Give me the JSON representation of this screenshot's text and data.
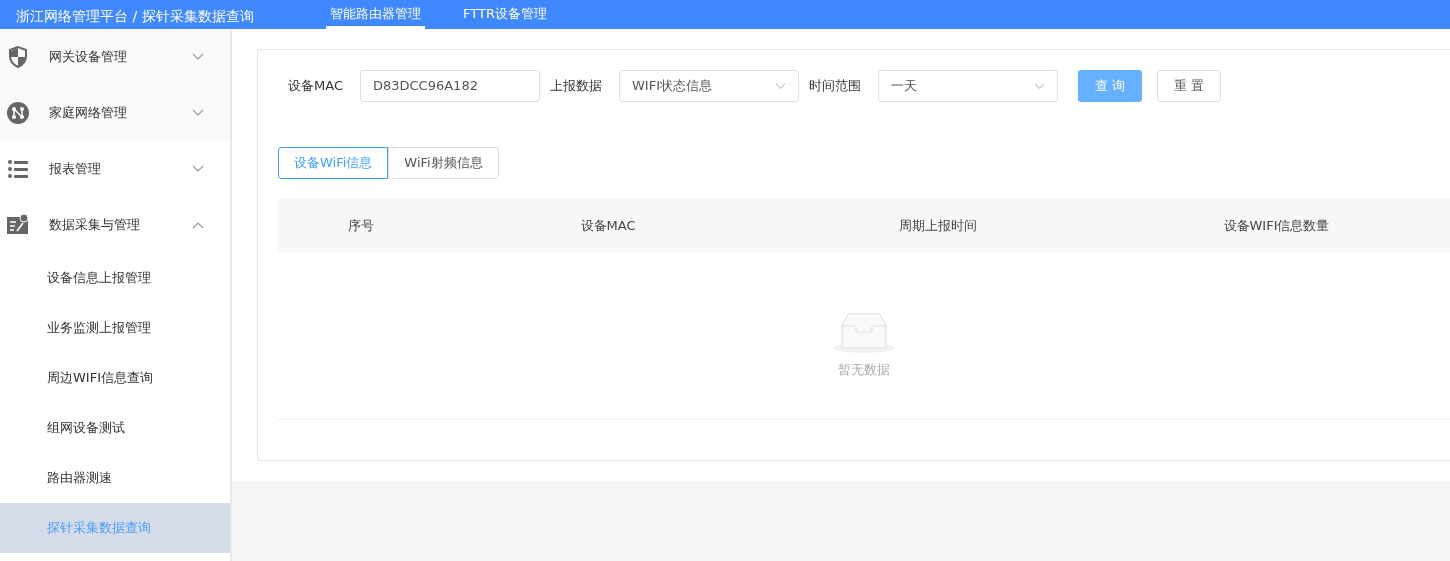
{
  "header": {
    "title": "浙江网络管理平台 / 探针采集数据查询",
    "tabs": [
      {
        "label": "智能路由器管理",
        "selected": true
      },
      {
        "label": "FTTR设备管理",
        "selected": false
      }
    ]
  },
  "sidebar": {
    "items": [
      {
        "label": "网关设备管理",
        "expanded": false
      },
      {
        "label": "家庭网络管理",
        "expanded": false
      },
      {
        "label": "报表管理",
        "expanded": false
      },
      {
        "label": "数据采集与管理",
        "expanded": true,
        "children": [
          {
            "label": "设备信息上报管理",
            "selected": false
          },
          {
            "label": "业务监测上报管理",
            "selected": false
          },
          {
            "label": "周边WIFI信息查询",
            "selected": false
          },
          {
            "label": "组网设备测试",
            "selected": false
          },
          {
            "label": "路由器测速",
            "selected": false
          },
          {
            "label": "探针采集数据查询",
            "selected": true
          }
        ]
      }
    ]
  },
  "filters": [
    {
      "kind": "input",
      "label": "设备MAC",
      "value": "D83DCC96A182"
    },
    {
      "kind": "select",
      "label": "上报数据",
      "value": "WIFI状态信息"
    },
    {
      "kind": "select",
      "label": "时间范围",
      "value": "一天"
    }
  ],
  "buttons": [
    {
      "kind": "primary",
      "label": "查 询"
    },
    {
      "kind": "default",
      "label": "重 置"
    }
  ],
  "tabs": [
    {
      "label": "设备WiFi信息",
      "selected": true
    },
    {
      "label": "WiFi射频信息",
      "selected": false
    }
  ],
  "table": {
    "columns": [
      "序号",
      "设备MAC",
      "周期上报时间",
      "设备WIFI信息数量"
    ],
    "empty_text": "暂无数据"
  }
}
